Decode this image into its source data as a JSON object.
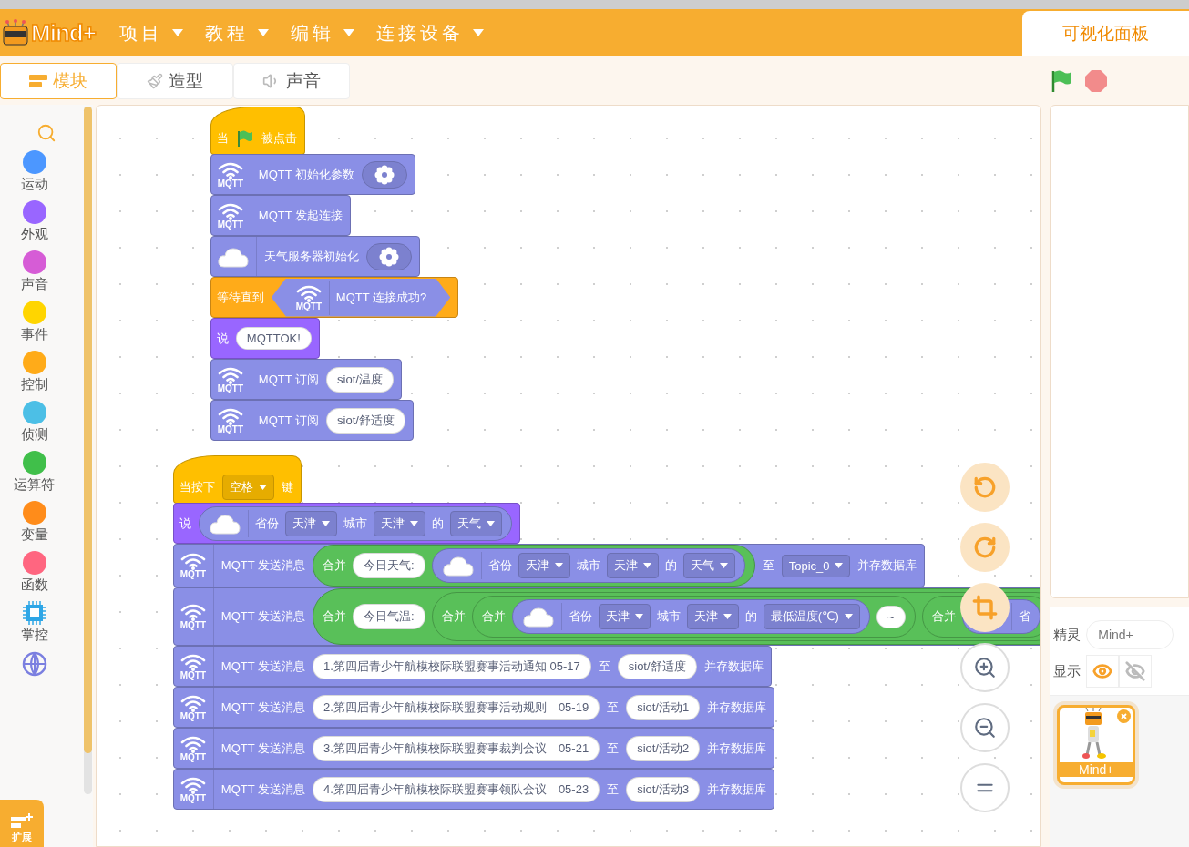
{
  "menu": {
    "logo": "Mind+",
    "items": [
      "项目",
      "教程",
      "编辑",
      "连接设备"
    ],
    "panel_tab": "可视化面板"
  },
  "tabs": [
    {
      "label": "模块",
      "kind": "code",
      "selected": true
    },
    {
      "label": "造型",
      "kind": "costume",
      "selected": false
    },
    {
      "label": "声音",
      "kind": "sound",
      "selected": false
    }
  ],
  "categories": [
    {
      "kind": "search"
    },
    {
      "kind": "dot",
      "label": "运动",
      "color": "#4c97ff"
    },
    {
      "kind": "dot",
      "label": "外观",
      "color": "#9966ff"
    },
    {
      "kind": "dot",
      "label": "声音",
      "color": "#d65cd6"
    },
    {
      "kind": "dot",
      "label": "事件",
      "color": "#ffd500"
    },
    {
      "kind": "dot",
      "label": "控制",
      "color": "#ffab19"
    },
    {
      "kind": "dot",
      "label": "侦测",
      "color": "#4cbfe6"
    },
    {
      "kind": "dot",
      "label": "运算符",
      "color": "#40bf4a"
    },
    {
      "kind": "dot",
      "label": "变量",
      "color": "#ff8c1a"
    },
    {
      "kind": "dot",
      "label": "函数",
      "color": "#ff6680"
    },
    {
      "kind": "chip",
      "label": "掌控"
    },
    {
      "kind": "globe"
    }
  ],
  "extension_button": "扩展",
  "scripts": [
    {
      "blocks": [
        {
          "kind": "hat",
          "color": "#ffbf00",
          "parts": [
            {
              "kind": "text",
              "text": "当"
            },
            {
              "kind": "flag"
            },
            {
              "kind": "text",
              "text": "被点击"
            }
          ]
        },
        {
          "kind": "stack",
          "color": "#8a8fe6",
          "icon": {
            "kind": "wifi",
            "label": "MQTT"
          },
          "parts": [
            {
              "kind": "text",
              "text": "MQTT 初始化参数"
            },
            {
              "kind": "gear"
            }
          ]
        },
        {
          "kind": "stack",
          "color": "#8a8fe6",
          "icon": {
            "kind": "wifi",
            "label": "MQTT"
          },
          "parts": [
            {
              "kind": "text",
              "text": "MQTT 发起连接"
            }
          ]
        },
        {
          "kind": "stack",
          "color": "#8a8fe6",
          "icon": {
            "kind": "cloud"
          },
          "parts": [
            {
              "kind": "text",
              "text": "天气服务器初始化"
            },
            {
              "kind": "gear"
            }
          ]
        },
        {
          "kind": "stack",
          "color": "#ffab19",
          "parts": [
            {
              "kind": "text",
              "text": "等待直到"
            },
            {
              "kind": "boolean",
              "color": "#8a8fe6",
              "icon": {
                "kind": "wifi",
                "label": "MQTT"
              },
              "parts": [
                {
                  "kind": "text",
                  "text": "MQTT 连接成功?"
                }
              ]
            }
          ]
        },
        {
          "kind": "stack",
          "color": "#9966ff",
          "parts": [
            {
              "kind": "text",
              "text": "说"
            },
            {
              "kind": "input",
              "text": "MQTTOK!"
            }
          ]
        },
        {
          "kind": "stack",
          "color": "#8a8fe6",
          "icon": {
            "kind": "wifi",
            "label": "MQTT"
          },
          "parts": [
            {
              "kind": "text",
              "text": "MQTT 订阅"
            },
            {
              "kind": "input",
              "text": "siot/温度"
            }
          ]
        },
        {
          "kind": "stack",
          "color": "#8a8fe6",
          "icon": {
            "kind": "wifi",
            "label": "MQTT"
          },
          "parts": [
            {
              "kind": "text",
              "text": "MQTT 订阅"
            },
            {
              "kind": "input",
              "text": "siot/舒适度"
            }
          ]
        }
      ]
    },
    {
      "blocks": [
        {
          "kind": "hat",
          "color": "#ffbf00",
          "parts": [
            {
              "kind": "text",
              "text": "当按下"
            },
            {
              "kind": "dropdown",
              "text": "空格"
            },
            {
              "kind": "text",
              "text": "键"
            }
          ]
        },
        {
          "kind": "stack",
          "color": "#9966ff",
          "parts": [
            {
              "kind": "text",
              "text": "说"
            },
            {
              "kind": "reporter",
              "color": "#8a8fe6",
              "icon": {
                "kind": "cloud"
              },
              "parts": [
                {
                  "kind": "text",
                  "text": "省份"
                },
                {
                  "kind": "dropdown",
                  "text": "天津"
                },
                {
                  "kind": "text",
                  "text": "城市"
                },
                {
                  "kind": "dropdown",
                  "text": "天津"
                },
                {
                  "kind": "text",
                  "text": "的"
                },
                {
                  "kind": "dropdown",
                  "text": "天气"
                }
              ]
            }
          ]
        },
        {
          "kind": "stack",
          "color": "#8a8fe6",
          "icon": {
            "kind": "wifi",
            "label": "MQTT"
          },
          "parts": [
            {
              "kind": "text",
              "text": "MQTT 发送消息"
            },
            {
              "kind": "reporter",
              "color": "#59c059",
              "parts": [
                {
                  "kind": "text",
                  "text": "合并"
                },
                {
                  "kind": "input",
                  "text": "今日天气:"
                },
                {
                  "kind": "reporter",
                  "color": "#8a8fe6",
                  "icon": {
                    "kind": "cloud"
                  },
                  "parts": [
                    {
                      "kind": "text",
                      "text": "省份"
                    },
                    {
                      "kind": "dropdown",
                      "text": "天津"
                    },
                    {
                      "kind": "text",
                      "text": "城市"
                    },
                    {
                      "kind": "dropdown",
                      "text": "天津"
                    },
                    {
                      "kind": "text",
                      "text": "的"
                    },
                    {
                      "kind": "dropdown",
                      "text": "天气"
                    }
                  ]
                }
              ]
            },
            {
              "kind": "text",
              "text": "至"
            },
            {
              "kind": "dropdown",
              "text": "Topic_0"
            },
            {
              "kind": "text",
              "text": "并存数据库"
            }
          ]
        },
        {
          "kind": "stack",
          "color": "#8a8fe6",
          "icon": {
            "kind": "wifi",
            "label": "MQTT"
          },
          "parts": [
            {
              "kind": "text",
              "text": "MQTT 发送消息"
            },
            {
              "kind": "reporter",
              "color": "#59c059",
              "parts": [
                {
                  "kind": "text",
                  "text": "合并"
                },
                {
                  "kind": "input",
                  "text": "今日气温:"
                },
                {
                  "kind": "reporter",
                  "color": "#59c059",
                  "parts": [
                    {
                      "kind": "text",
                      "text": "合并"
                    },
                    {
                      "kind": "reporter",
                      "color": "#59c059",
                      "parts": [
                        {
                          "kind": "text",
                          "text": "合并"
                        },
                        {
                          "kind": "reporter",
                          "color": "#8a8fe6",
                          "icon": {
                            "kind": "cloud"
                          },
                          "parts": [
                            {
                              "kind": "text",
                              "text": "省份"
                            },
                            {
                              "kind": "dropdown",
                              "text": "天津"
                            },
                            {
                              "kind": "text",
                              "text": "城市"
                            },
                            {
                              "kind": "dropdown",
                              "text": "天津"
                            },
                            {
                              "kind": "text",
                              "text": "的"
                            },
                            {
                              "kind": "dropdown",
                              "text": "最低温度(℃)"
                            }
                          ]
                        },
                        {
                          "kind": "input",
                          "text": "~"
                        }
                      ]
                    },
                    {
                      "kind": "reporter",
                      "color": "#59c059",
                      "parts": [
                        {
                          "kind": "text",
                          "text": "合并"
                        },
                        {
                          "kind": "reporter",
                          "color": "#8a8fe6",
                          "icon": {
                            "kind": "cloud"
                          },
                          "parts": [
                            {
                              "kind": "text",
                              "text": "省"
                            }
                          ]
                        }
                      ]
                    }
                  ]
                }
              ]
            }
          ]
        },
        {
          "kind": "stack",
          "color": "#8a8fe6",
          "icon": {
            "kind": "wifi",
            "label": "MQTT"
          },
          "parts": [
            {
              "kind": "text",
              "text": "MQTT 发送消息"
            },
            {
              "kind": "input",
              "text": "1.第四届青少年航模校际联盟赛事活动通知 05-17"
            },
            {
              "kind": "text",
              "text": "至"
            },
            {
              "kind": "input",
              "text": "siot/舒适度"
            },
            {
              "kind": "text",
              "text": "并存数据库"
            }
          ]
        },
        {
          "kind": "stack",
          "color": "#8a8fe6",
          "icon": {
            "kind": "wifi",
            "label": "MQTT"
          },
          "parts": [
            {
              "kind": "text",
              "text": "MQTT 发送消息"
            },
            {
              "kind": "input",
              "text": "2.第四届青少年航模校际联盟赛事活动规则　05-19"
            },
            {
              "kind": "text",
              "text": "至"
            },
            {
              "kind": "input",
              "text": "siot/活动1"
            },
            {
              "kind": "text",
              "text": "并存数据库"
            }
          ]
        },
        {
          "kind": "stack",
          "color": "#8a8fe6",
          "icon": {
            "kind": "wifi",
            "label": "MQTT"
          },
          "parts": [
            {
              "kind": "text",
              "text": "MQTT 发送消息"
            },
            {
              "kind": "input",
              "text": "3.第四届青少年航模校际联盟赛事裁判会议　05-21"
            },
            {
              "kind": "text",
              "text": "至"
            },
            {
              "kind": "input",
              "text": "siot/活动2"
            },
            {
              "kind": "text",
              "text": "并存数据库"
            }
          ]
        },
        {
          "kind": "stack",
          "color": "#8a8fe6",
          "icon": {
            "kind": "wifi",
            "label": "MQTT"
          },
          "parts": [
            {
              "kind": "text",
              "text": "MQTT 发送消息"
            },
            {
              "kind": "input",
              "text": "4.第四届青少年航模校际联盟赛事领队会议　05-23"
            },
            {
              "kind": "text",
              "text": "至"
            },
            {
              "kind": "input",
              "text": "siot/活动3"
            },
            {
              "kind": "text",
              "text": "并存数据库"
            }
          ]
        }
      ]
    }
  ],
  "sprite": {
    "label": "精灵",
    "name": "Mind+",
    "show_label": "显示",
    "visible": true
  },
  "sprites": [
    {
      "name": "Mind+",
      "selected": true
    }
  ]
}
